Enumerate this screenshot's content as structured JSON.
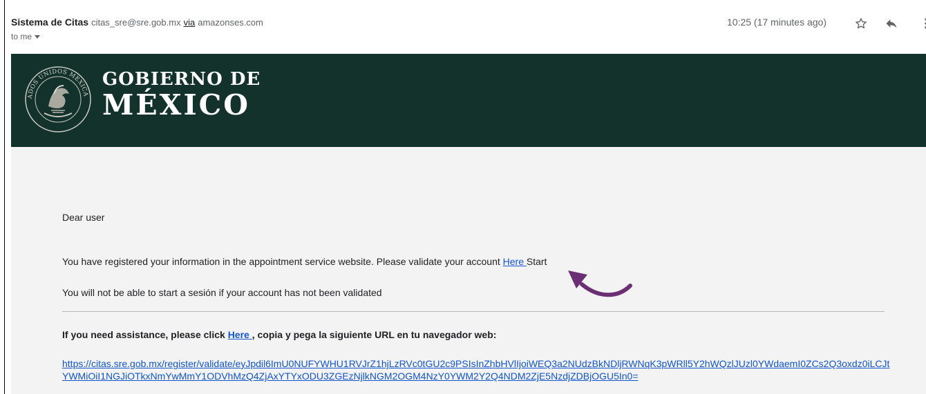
{
  "email": {
    "sender_name": "Sistema de Citas",
    "sender_email": "citas_sre@sre.gob.mx",
    "via_label": "via",
    "via_domain": "amazonses.com",
    "recipient": "to me",
    "time": "10:25 (17 minutes ago)",
    "icons": [
      "star-icon",
      "reply-icon",
      "more-vert-icon"
    ]
  },
  "banner": {
    "logo_text": "ESTADOS UNIDOS MEXICANOS",
    "title_line1": "GOBIERNO DE",
    "title_line2": "MÉXICO",
    "background": "#13322b"
  },
  "body": {
    "greeting": "Dear user",
    "para1_before": "You have registered your information in the appointment service website. Please validate your account ",
    "para1_link": "Here ",
    "para1_after": "Start",
    "para2": "You will not be able to start a sesión if your account has not been validated",
    "assist_before": "If you need assistance, please click ",
    "assist_link": "Here ",
    "assist_after": ", copia y pega la siguiente URL en tu navegador web:",
    "url": "https://citas.sre.gob.mx/register/validate/eyJpdil6ImU0NUFYWHU1RVJrZ1hjLzRVc0tGU2c9PSIsInZhbHVlIjoiWEQ3a2NUdzBkNDljRWNqK3pWRll5Y2hWQzlJUzl0YWdaemI0ZCs2Q3oxdz0iLCJtYWMiOiI1NGJiOTkxNmYwMmY1ODVhMzQ4ZjAxYTYxODU3ZGEzNjlkNGM2OGM4NzY0YWM2Y2Q4NDM2ZjE5NzdjZDBjOGU5In0="
  },
  "colors": {
    "link": "#1155cc",
    "annotation_arrow": "#6b2f73",
    "content_background": "#f3f3f3"
  }
}
